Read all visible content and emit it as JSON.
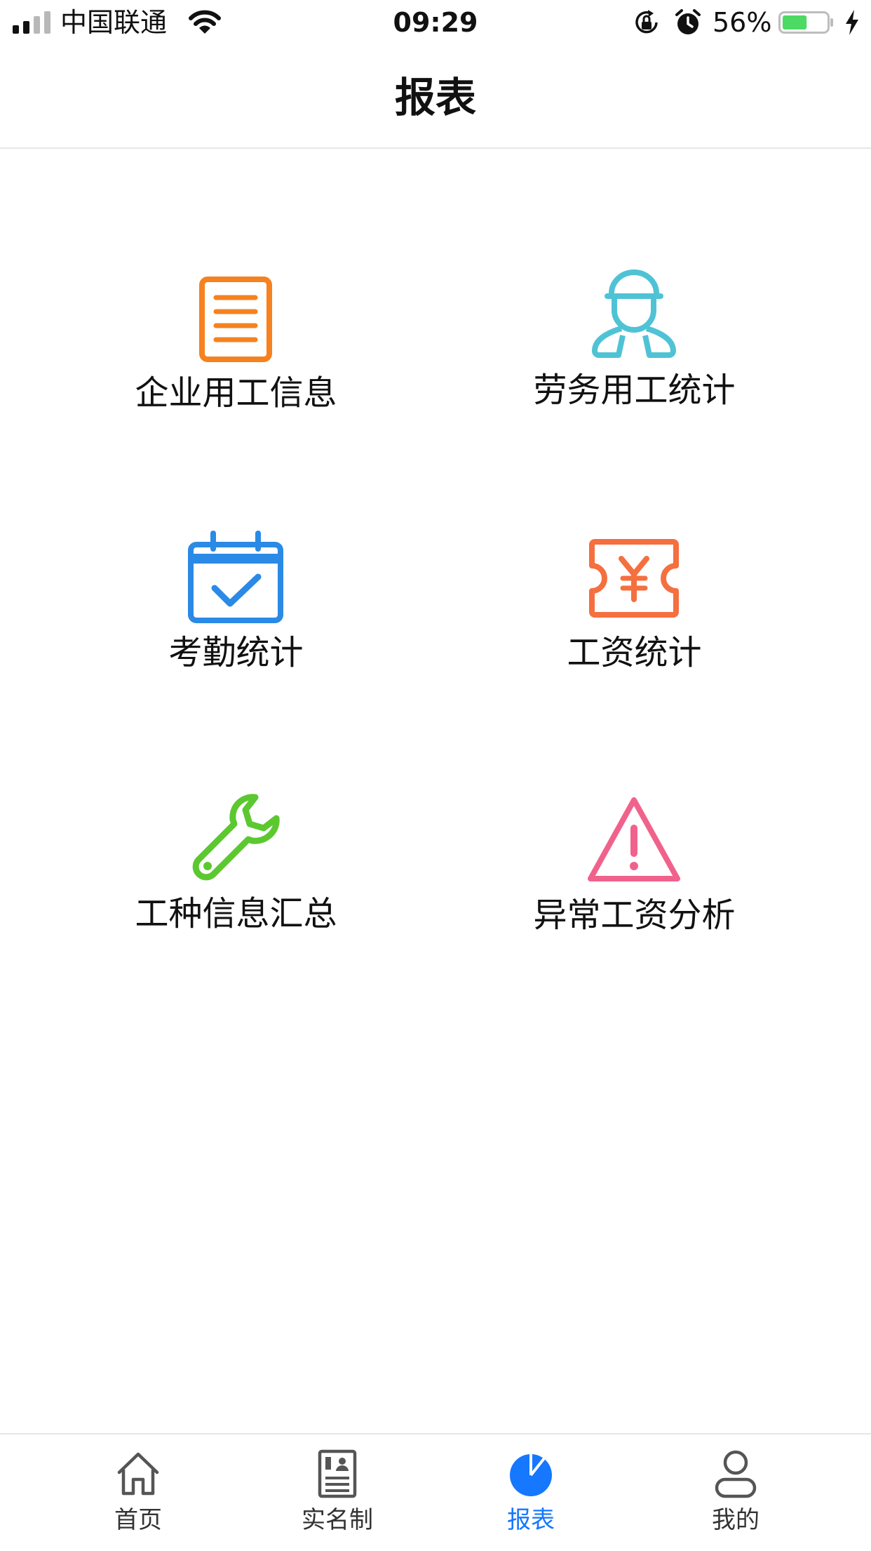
{
  "status_bar": {
    "carrier": "中国联通",
    "time": "09:29",
    "battery_percent": "56%",
    "battery_level": 0.56,
    "icons": [
      "signal-icon",
      "wifi-icon",
      "rotation-lock-icon",
      "alarm-icon",
      "battery-icon",
      "charging-icon"
    ]
  },
  "header": {
    "title": "报表"
  },
  "grid": {
    "items": [
      {
        "label": "企业用工信息",
        "icon": "document-icon",
        "color": "#f5821f"
      },
      {
        "label": "劳务用工统计",
        "icon": "worker-icon",
        "color": "#4fc3d5"
      },
      {
        "label": "考勤统计",
        "icon": "calendar-check-icon",
        "color": "#2a8ae6"
      },
      {
        "label": "工资统计",
        "icon": "yuan-ticket-icon",
        "color": "#f56f3f"
      },
      {
        "label": "工种信息汇总",
        "icon": "wrench-icon",
        "color": "#5cc830"
      },
      {
        "label": "异常工资分析",
        "icon": "warning-icon",
        "color": "#f0628c"
      }
    ]
  },
  "tab_bar": {
    "active_color": "#1677ff",
    "inactive_color": "#555555",
    "items": [
      {
        "label": "首页",
        "icon": "home-icon"
      },
      {
        "label": "实名制",
        "icon": "id-card-icon"
      },
      {
        "label": "报表",
        "icon": "pie-chart-icon",
        "active": true
      },
      {
        "label": "我的",
        "icon": "person-icon"
      }
    ]
  }
}
